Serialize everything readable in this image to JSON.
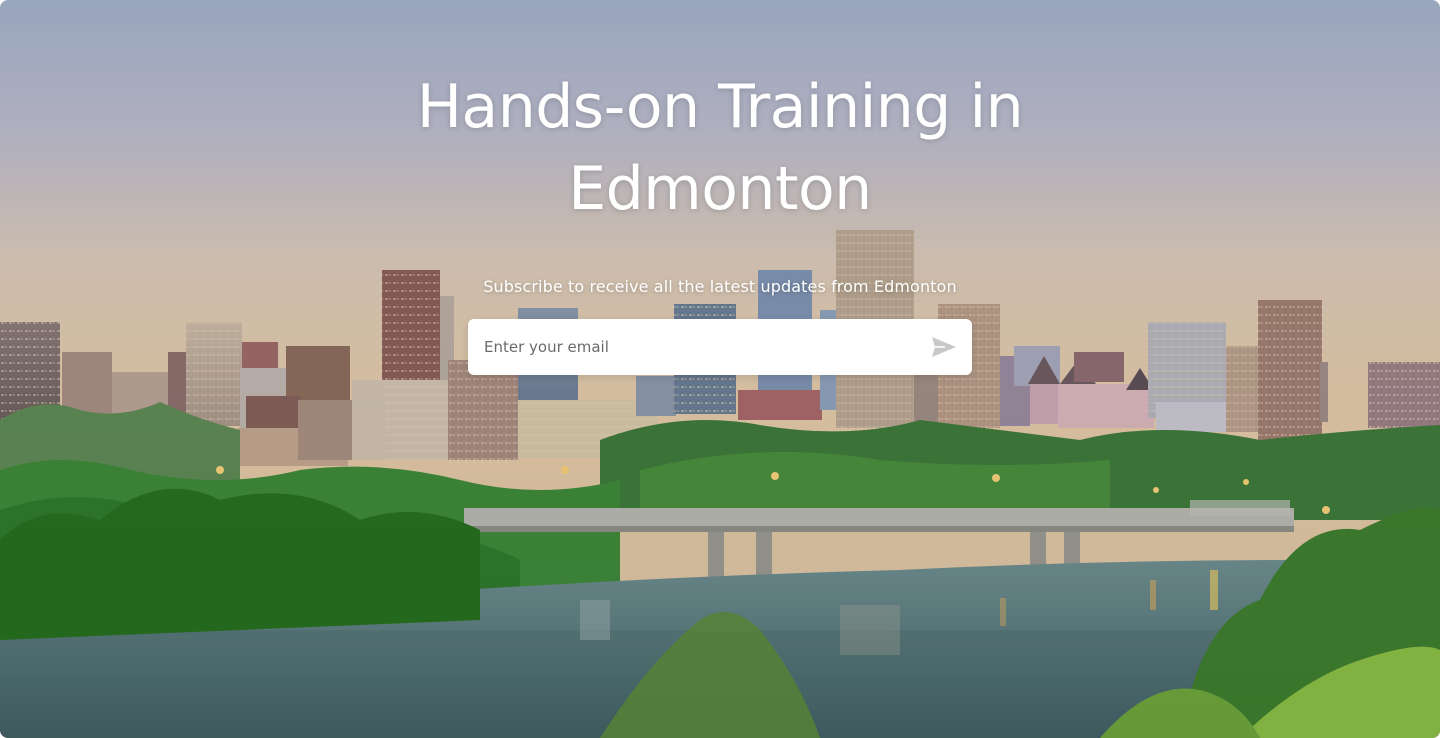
{
  "hero": {
    "title_line1": "Hands-on Training in",
    "title_line2": "Edmonton",
    "subscribe_text": "Subscribe to receive all the latest updates from Edmonton"
  },
  "subscribe_form": {
    "email_placeholder": "Enter your email",
    "email_value": "",
    "send_icon": "send-icon"
  },
  "colors": {
    "title_text": "#ffffff",
    "input_background": "#ffffff",
    "placeholder_text": "#6b6b6b",
    "send_icon": "#c8c8c8"
  }
}
